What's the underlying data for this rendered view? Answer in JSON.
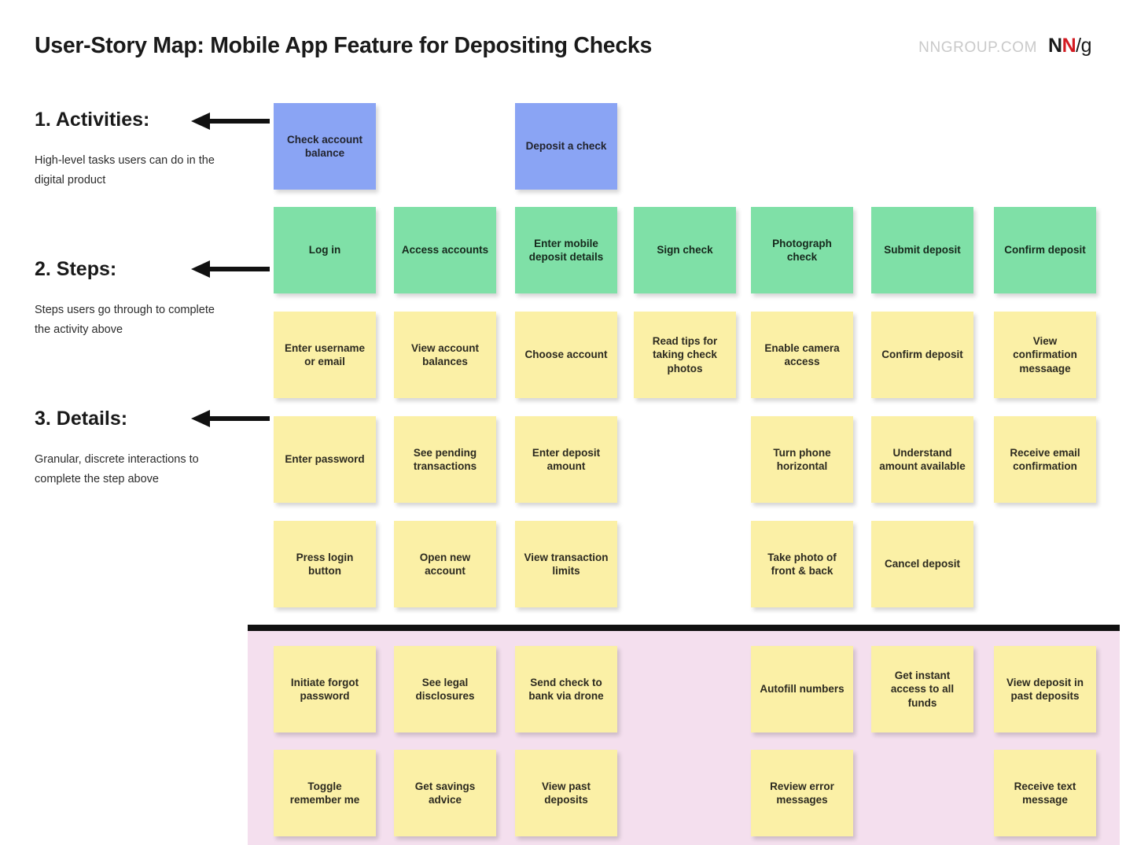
{
  "header": {
    "title": "User-Story Map: Mobile App Feature for Depositing Checks",
    "brand_url": "NNGROUP.COM",
    "logo_n1": "N",
    "logo_n2": "N",
    "logo_slash": "/g"
  },
  "legend": [
    {
      "heading": "1. Activities:",
      "description": "High-level tasks users can do in the digital product"
    },
    {
      "heading": "2. Steps:",
      "description": "Steps users go through to complete the activity above"
    },
    {
      "heading": "3. Details:",
      "description": "Granular, discrete interactions to complete the step above"
    }
  ],
  "colors": {
    "activity": "#8aa4f4",
    "step": "#7fe0a7",
    "detail": "#fbf0a6",
    "below_the_line_band": "#f4dfee",
    "divider": "#111111",
    "brand_red": "#d31b22"
  },
  "map": {
    "columns": 7,
    "activities": [
      {
        "col": 0,
        "label": "Check account balance"
      },
      {
        "col": 2,
        "label": "Deposit a check"
      }
    ],
    "steps": [
      {
        "col": 0,
        "label": "Log in"
      },
      {
        "col": 1,
        "label": "Access accounts"
      },
      {
        "col": 2,
        "label": "Enter mobile deposit details"
      },
      {
        "col": 3,
        "label": "Sign check"
      },
      {
        "col": 4,
        "label": "Photograph check"
      },
      {
        "col": 5,
        "label": "Submit deposit"
      },
      {
        "col": 6,
        "label": "Confirm deposit"
      }
    ],
    "details_rows": [
      [
        {
          "col": 0,
          "label": "Enter username or email"
        },
        {
          "col": 1,
          "label": "View account balances"
        },
        {
          "col": 2,
          "label": "Choose account"
        },
        {
          "col": 3,
          "label": "Read tips for taking check photos"
        },
        {
          "col": 4,
          "label": "Enable camera access"
        },
        {
          "col": 5,
          "label": "Confirm deposit"
        },
        {
          "col": 6,
          "label": "View confirmation messaage"
        }
      ],
      [
        {
          "col": 0,
          "label": "Enter password"
        },
        {
          "col": 1,
          "label": "See pending transactions"
        },
        {
          "col": 2,
          "label": "Enter deposit amount"
        },
        {
          "col": 4,
          "label": "Turn phone horizontal"
        },
        {
          "col": 5,
          "label": "Understand amount available"
        },
        {
          "col": 6,
          "label": "Receive email confirmation"
        }
      ],
      [
        {
          "col": 0,
          "label": "Press login button"
        },
        {
          "col": 1,
          "label": "Open new account"
        },
        {
          "col": 2,
          "label": "View transaction limits"
        },
        {
          "col": 4,
          "label": "Take photo of front & back"
        },
        {
          "col": 5,
          "label": "Cancel deposit"
        }
      ]
    ],
    "below_the_line_rows": [
      [
        {
          "col": 0,
          "label": "Initiate forgot password"
        },
        {
          "col": 1,
          "label": "See legal disclosures"
        },
        {
          "col": 2,
          "label": "Send check to bank via drone"
        },
        {
          "col": 4,
          "label": "Autofill numbers"
        },
        {
          "col": 5,
          "label": "Get instant access to all funds"
        },
        {
          "col": 6,
          "label": "View deposit in past deposits"
        }
      ],
      [
        {
          "col": 0,
          "label": "Toggle remember me"
        },
        {
          "col": 1,
          "label": "Get savings advice"
        },
        {
          "col": 2,
          "label": "View past deposits"
        },
        {
          "col": 4,
          "label": "Review error messages"
        },
        {
          "col": 6,
          "label": "Receive text message"
        }
      ]
    ]
  }
}
